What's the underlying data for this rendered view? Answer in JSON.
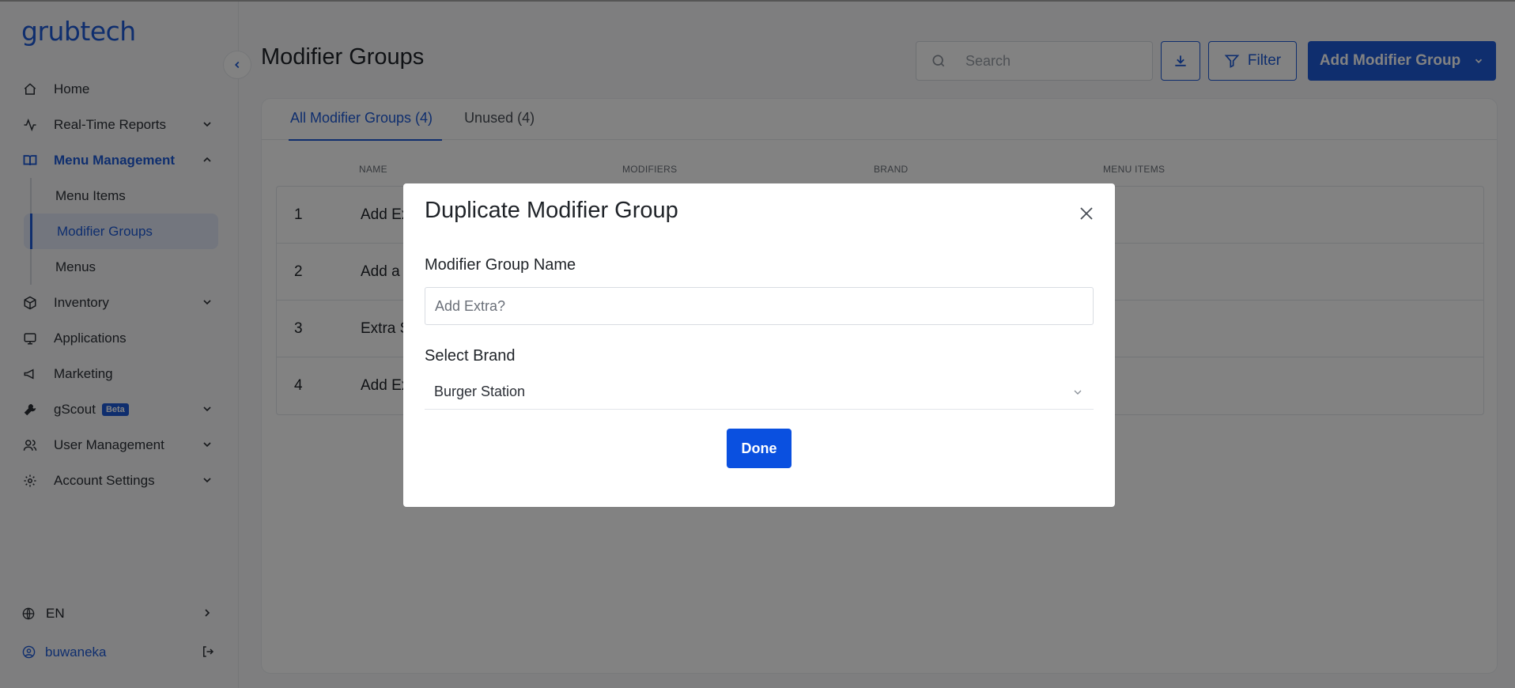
{
  "app": {
    "logo_text": "grubtech",
    "accent": "#1e5bd8"
  },
  "sidebar": {
    "items": [
      {
        "label": "Home",
        "icon": "home-icon",
        "has_chevron": false
      },
      {
        "label": "Real-Time Reports",
        "icon": "activity-icon",
        "has_chevron": true
      },
      {
        "label": "Menu Management",
        "icon": "book-open-icon",
        "has_chevron": true,
        "expanded": true,
        "active": true
      },
      {
        "label": "Inventory",
        "icon": "box-icon",
        "has_chevron": true
      },
      {
        "label": "Applications",
        "icon": "monitor-icon",
        "has_chevron": false
      },
      {
        "label": "Marketing",
        "icon": "megaphone-icon",
        "has_chevron": false
      },
      {
        "label": "gScout",
        "icon": "wrench-icon",
        "has_chevron": true,
        "badge": "Beta"
      },
      {
        "label": "User Management",
        "icon": "users-icon",
        "has_chevron": true
      },
      {
        "label": "Account Settings",
        "icon": "gear-icon",
        "has_chevron": true
      }
    ],
    "menu_management_sub": [
      {
        "label": "Menu Items"
      },
      {
        "label": "Modifier Groups",
        "selected": true
      },
      {
        "label": "Menus"
      }
    ],
    "language": "EN",
    "user": "buwaneka"
  },
  "header": {
    "title": "Modifier Groups",
    "search_placeholder": "Search",
    "filter_label": "Filter",
    "add_label": "Add Modifier Group"
  },
  "tabs": [
    {
      "label": "All Modifier Groups (4)",
      "active": true
    },
    {
      "label": "Unused (4)",
      "active": false
    }
  ],
  "table": {
    "columns": [
      "NAME",
      "MODIFIERS",
      "BRAND",
      "MENU ITEMS"
    ],
    "rows": [
      {
        "index": "1",
        "name": "Add Ex"
      },
      {
        "index": "2",
        "name": "Add a"
      },
      {
        "index": "3",
        "name": "Extra S"
      },
      {
        "index": "4",
        "name": "Add Ex"
      }
    ]
  },
  "modal": {
    "title": "Duplicate Modifier Group",
    "name_label": "Modifier Group Name",
    "name_placeholder": "Add Extra?",
    "brand_label": "Select Brand",
    "brand_value": "Burger Station",
    "done_label": "Done"
  }
}
